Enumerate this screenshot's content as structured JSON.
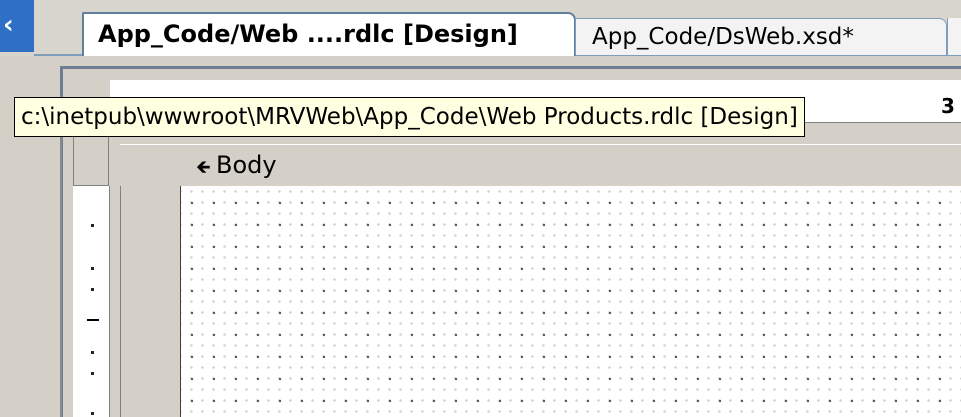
{
  "tabs": [
    {
      "label": "App_Code/Web ....rdlc [Design]",
      "active": true
    },
    {
      "label": "App_Code/DsWeb.xsd*",
      "active": false
    }
  ],
  "tooltip": {
    "path": "c:\\inetpub\\wwwroot\\MRVWeb\\App_Code\\Web Products.rdlc [Design]"
  },
  "ruler": {
    "number": "3"
  },
  "designer": {
    "section_label": "Body"
  },
  "icons": {
    "scroll_left": "chevron-left-icon",
    "section": "section-arrow-icon"
  },
  "colors": {
    "accent": "#2f6fc5",
    "tooltip_bg": "#ffffe1",
    "surface": "#ffffff",
    "chrome": "#d4d0c8"
  }
}
